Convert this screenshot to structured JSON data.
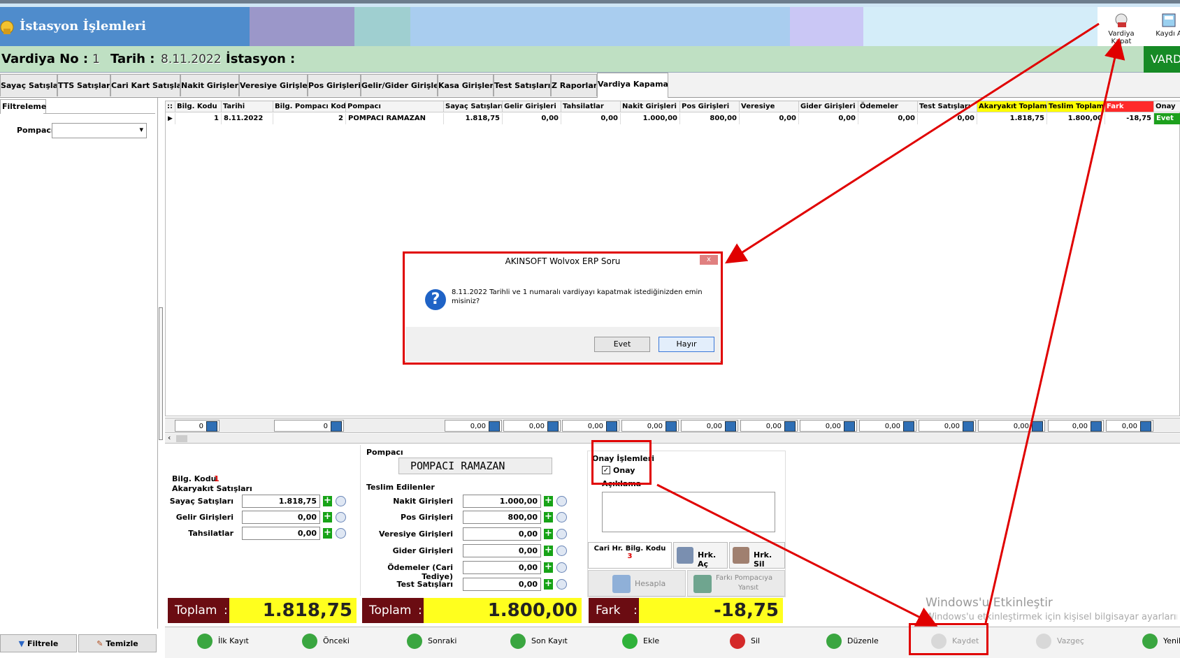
{
  "app": {
    "title": "İstasyon İşlemleri",
    "toolbar": {
      "close_shift": "Vardiya Kapat",
      "save_close": "Kaydı A"
    }
  },
  "info": {
    "shift_no_label": "Vardiya No :",
    "shift_no": "1",
    "date_label": "Tarih :",
    "date": "8.11.2022",
    "station_label": "İstasyon :",
    "right_button": "VARD"
  },
  "tabs": [
    "Sayaç Satışları",
    "TTS Satışları",
    "Cari Kart Satışları",
    "Nakit Girişleri",
    "Veresiye Girişleri",
    "Pos Girişleri",
    "Gelir/Gider Girişleri",
    "Kasa Girişleri",
    "Test Satışları",
    "Z Raporları",
    "Vardiya Kapama"
  ],
  "filter": {
    "tab_label": "Filtreleme",
    "pompaci_label": "Pompacı",
    "filter_button": "Filtrele",
    "clear_button": "Temizle"
  },
  "grid": {
    "headers": [
      "Bilg. Kodu",
      "Tarihi",
      "Bilg. Pompacı Kodu",
      "Pompacı",
      "Sayaç Satışları",
      "Gelir Girişleri",
      "Tahsilatlar",
      "Nakit Girişleri",
      "Pos Girişleri",
      "Veresiye",
      "Gider Girişleri",
      "Ödemeler",
      "Test Satışları",
      "Akaryakıt Toplam",
      "Teslim Toplam",
      "Fark",
      "Onay"
    ],
    "row": [
      "1",
      "8.11.2022",
      "2",
      "POMPACI RAMAZAN",
      "1.818,75",
      "0,00",
      "0,00",
      "1.000,00",
      "800,00",
      "0,00",
      "0,00",
      "0,00",
      "0,00",
      "1.818,75",
      "1.800,00",
      "-18,75",
      "Evet"
    ],
    "footer_totals": [
      "0",
      "0",
      "0,00",
      "0,00",
      "0,00",
      "0,00",
      "0,00",
      "0,00",
      "0,00",
      "0,00",
      "0,00",
      "0,00",
      "0,00",
      "0,00"
    ]
  },
  "detail": {
    "bilg_kodu_label": "Bilg. Kodu",
    "bilg_kodu": "1",
    "akaryakit_title": "Akaryakıt Satışları",
    "akaryakit": [
      {
        "label": "Sayaç Satışları",
        "value": "1.818,75"
      },
      {
        "label": "Gelir Girişleri",
        "value": "0,00"
      },
      {
        "label": "Tahsilatlar",
        "value": "0,00"
      }
    ],
    "pompaci_label": "Pompacı",
    "pompaci_value": "POMPACI RAMAZAN",
    "teslim_title": "Teslim Edilenler",
    "teslim": [
      {
        "label": "Nakit Girişleri",
        "value": "1.000,00"
      },
      {
        "label": "Pos Girişleri",
        "value": "800,00"
      },
      {
        "label": "Veresiye Girişleri",
        "value": "0,00"
      },
      {
        "label": "Gider Girişleri",
        "value": "0,00"
      },
      {
        "label": "Ödemeler (Cari Tediye)",
        "value": "0,00"
      },
      {
        "label": "Test Satışları",
        "value": "0,00"
      }
    ],
    "onay_title": "Onay İşlemleri",
    "onay_checkbox": "Onay",
    "aciklama_label": "Açıklama",
    "cari_label": "Cari Hr. Bilg. Kodu",
    "cari_value": "3",
    "hrk_ac": "Hrk. Aç",
    "hrk_sil": "Hrk. Sil",
    "hesapla": "Hesapla",
    "farki_line1": "Farkı Pompacıya",
    "farki_line2": "Yansıt",
    "totals": [
      {
        "label": "Toplam",
        "sep": ":",
        "value": "1.818,75"
      },
      {
        "label": "Toplam",
        "sep": ":",
        "value": "1.800,00"
      },
      {
        "label": "Fark",
        "sep": ":",
        "value": "-18,75"
      }
    ]
  },
  "bottombar": [
    "İlk Kayıt",
    "Önceki",
    "Sonraki",
    "Son Kayıt",
    "Ekle",
    "Sil",
    "Düzenle",
    "Kaydet",
    "Vazgeç",
    "Yenile"
  ],
  "dialog": {
    "title": "AKINSOFT Wolvox ERP Soru",
    "close": "x",
    "message": "8.11.2022 Tarihli ve 1 numaralı vardiyayı kapatmak istediğinizden emin misiniz?",
    "yes": "Evet",
    "no": "Hayır"
  },
  "watermark": {
    "line1": "Windows'u Etkinleştir",
    "line2": "Windows'u etkinleştirmek için kişisel bilgisayar ayarlarına gidin."
  },
  "colors": {
    "annotation_red": "#e00000",
    "total_yellow": "#ffff1e",
    "total_label": "#6b0c12"
  }
}
